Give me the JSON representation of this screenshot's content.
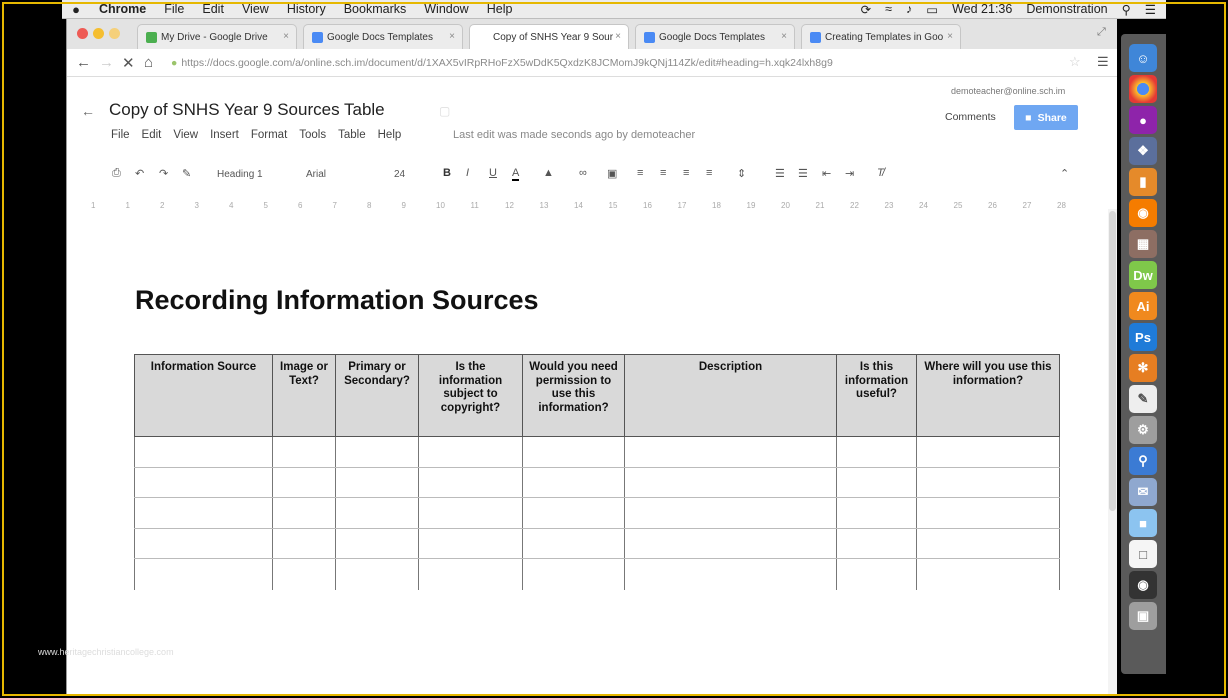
{
  "menubar": {
    "apple": "",
    "items": [
      "Chrome",
      "File",
      "Edit",
      "View",
      "History",
      "Bookmarks",
      "Window",
      "Help"
    ],
    "clock": "Wed 21:36",
    "user": "Demonstration"
  },
  "browser": {
    "tabs": [
      {
        "label": "My Drive - Google Drive"
      },
      {
        "label": "Google Docs Templates"
      },
      {
        "label": "Copy of SNHS Year 9 Sour"
      },
      {
        "label": "Google Docs Templates"
      },
      {
        "label": "Creating Templates in Goo"
      }
    ],
    "url": "https://docs.google.com/a/online.sch.im/document/d/1XAX5vIRpRHoFzX5wDdK5QxdzK8JCMomJ9kQNj114Zk/edit#heading=h.xqk24lxh8g9"
  },
  "docs": {
    "title": "Copy of SNHS Year 9 Sources Table",
    "account": "demoteacher@online.sch.im",
    "menus": [
      "File",
      "Edit",
      "View",
      "Insert",
      "Format",
      "Tools",
      "Table",
      "Help"
    ],
    "last_edit": "Last edit was made seconds ago by demoteacher",
    "comments_label": "Comments",
    "share_label": "Share",
    "style_select": "Heading 1",
    "font_select": "Arial",
    "size_select": "24",
    "bold": "B",
    "italic": "I",
    "underline": "U",
    "text_color": "A",
    "ruler_ticks": [
      "1",
      "1",
      "2",
      "3",
      "4",
      "5",
      "6",
      "7",
      "8",
      "9",
      "10",
      "11",
      "12",
      "13",
      "14",
      "15",
      "16",
      "17",
      "18",
      "19",
      "20",
      "21",
      "22",
      "23",
      "24",
      "25",
      "26",
      "27",
      "28"
    ]
  },
  "document": {
    "heading": "Recording Information Sources",
    "table": {
      "headers": [
        "Information Source",
        "Image or Text?",
        "Primary or Secondary?",
        "Is the information subject to copyright?",
        "Would you need permission to use this information?",
        "Description",
        "Is this information useful?",
        "Where will you use this information?"
      ],
      "empty_rows": 5
    }
  },
  "watermark": "www.heritagechristiancollege.com",
  "dock": {
    "apps": [
      "Finder",
      "Chrome",
      "Cortana",
      "Safari",
      "Slides",
      "Firefox",
      "Preview",
      "Dw",
      "Ai",
      "Ps",
      "Blender",
      "Notes",
      "Settings",
      "Spotlight",
      "Mail",
      "Folder",
      "File",
      "Photos",
      "Trash"
    ]
  },
  "colors": {
    "share": "#6fa7f2",
    "table_header": "#d9d9d9",
    "dw": "#7fc84a",
    "ai": "#f0891e",
    "ps": "#1f7bd8"
  }
}
